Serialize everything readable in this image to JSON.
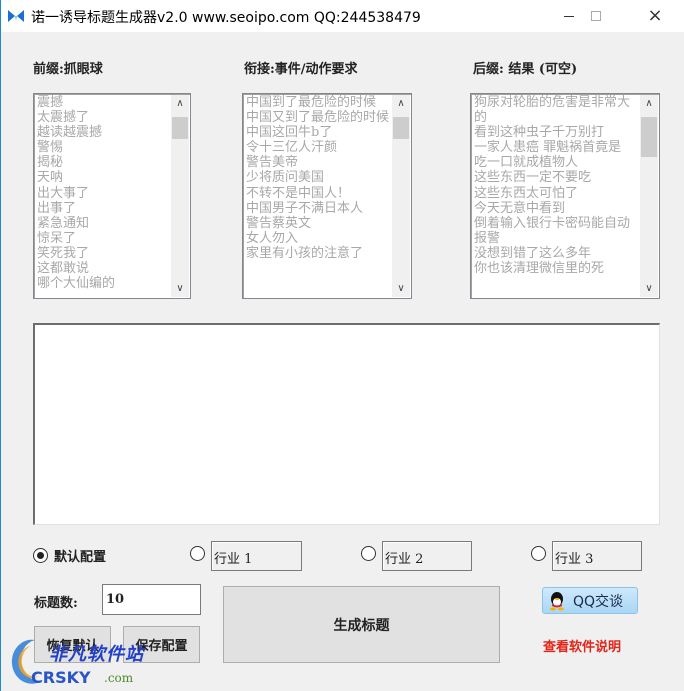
{
  "window": {
    "title": "诺一诱导标题生成器v2.0 www.seoipo.com QQ:244538479",
    "minimize_label": "minimize",
    "maximize_label": "maximize",
    "close_label": "×"
  },
  "groups": [
    {
      "label": "前缀:抓眼球",
      "items": [
        "震撼",
        "太震撼了",
        "越读越震撼",
        "警惕",
        "揭秘",
        "天呐",
        "出大事了",
        "出事了",
        "紧急通知",
        "惊呆了",
        "笑死我了",
        "这都敢说",
        "哪个大仙编的"
      ]
    },
    {
      "label": "衔接:事件/动作要求",
      "items": [
        "中国到了最危险的时候",
        "中国又到了最危险的时候",
        "中国这回牛b了",
        "令十三亿人汗颜",
        "警告美帝",
        "少将质问美国",
        "不转不是中国人！",
        "中国男子不满日本人",
        "警告蔡英文",
        "女人勿入",
        "家里有小孩的注意了"
      ]
    },
    {
      "label": "后缀: 结果 (可空)",
      "items": [
        "狗尿对轮胎的危害是非常大的",
        "看到这种虫子千万别打",
        "一家人患癌 罪魁祸首竟是",
        "吃一口就成植物人",
        "这些东西一定不要吃",
        "这些东西太可怕了",
        "今天无意中看到",
        "倒着输入银行卡密码能自动报警",
        "没想到错了这么多年",
        "你也该清理微信里的死"
      ]
    }
  ],
  "output": {
    "value": ""
  },
  "config": {
    "options": [
      {
        "label": "默认配置",
        "checked": true
      },
      {
        "label": "",
        "field": "行业 1",
        "checked": false
      },
      {
        "label": "",
        "field": "行业 2",
        "checked": false
      },
      {
        "label": "",
        "field": "行业 3",
        "checked": false
      }
    ]
  },
  "count": {
    "label": "标题数:",
    "value": "10"
  },
  "buttons": {
    "restore": "恢复默认",
    "save": "保存配置",
    "generate": "生成标题",
    "qq": "QQ交谈",
    "help": "查看软件说明"
  },
  "colors": {
    "help_link": "#e0261a",
    "qq_button": "#a9d6f5",
    "window_border": "#1e8ad6"
  },
  "watermark": {
    "cn": "非凡软件站",
    "en": "CRSKY",
    "com": ".com"
  }
}
